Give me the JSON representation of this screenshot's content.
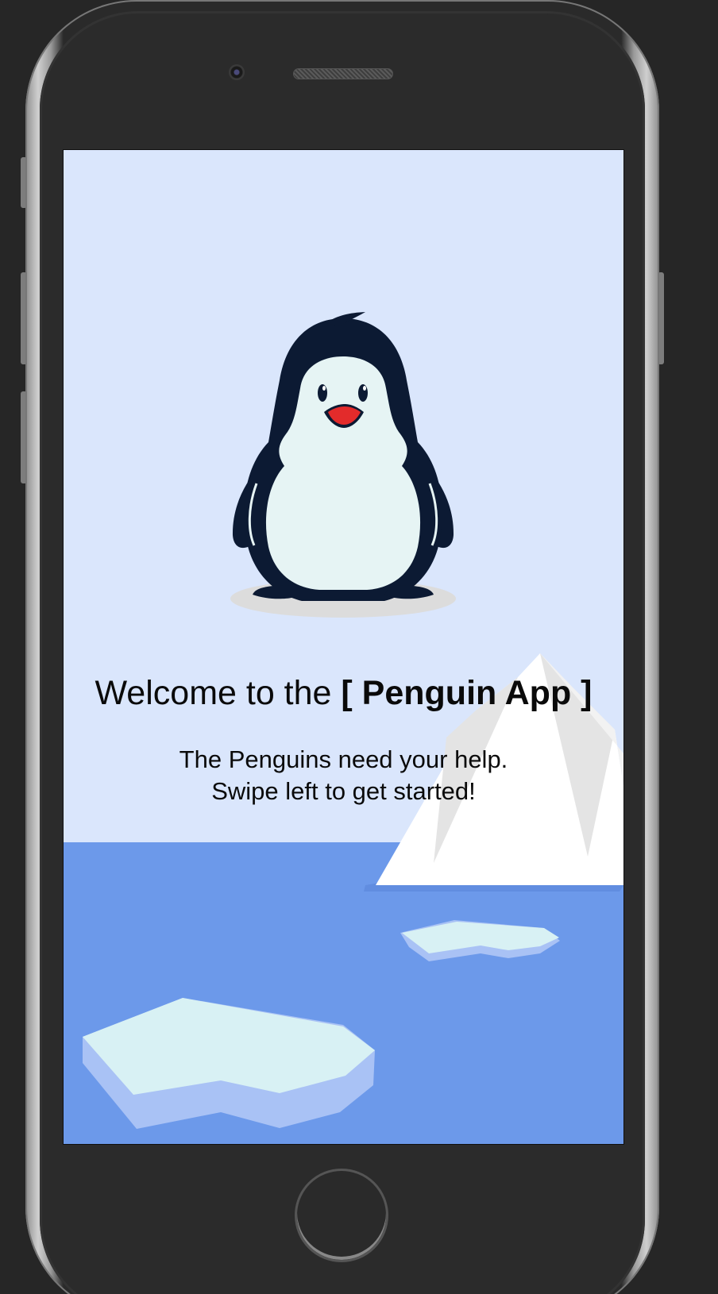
{
  "device": {
    "model": "smartphone-mockup",
    "frame_color": "#2a2a2a",
    "bezel_color": "#bdbdbd"
  },
  "screen": {
    "background_sky": "#dae6fc",
    "background_sea": "#6c99ea",
    "welcome": {
      "prefix": "Welcome to the ",
      "app_name": "[ Penguin App ]"
    },
    "message": {
      "line1": "The Penguins need your help.",
      "line2": "Swipe left to get started!"
    },
    "illustration": {
      "character": "penguin-icon",
      "body_color": "#0c1a33",
      "belly_color": "#e6f4f4",
      "beak_color": "#e32b2b",
      "iceberg_color": "#ffffff",
      "ice_floe_color": "#d8f1f4"
    }
  },
  "icons": {
    "camera": "camera-icon",
    "speaker": "speaker-grille-icon",
    "home": "home-button-icon"
  }
}
